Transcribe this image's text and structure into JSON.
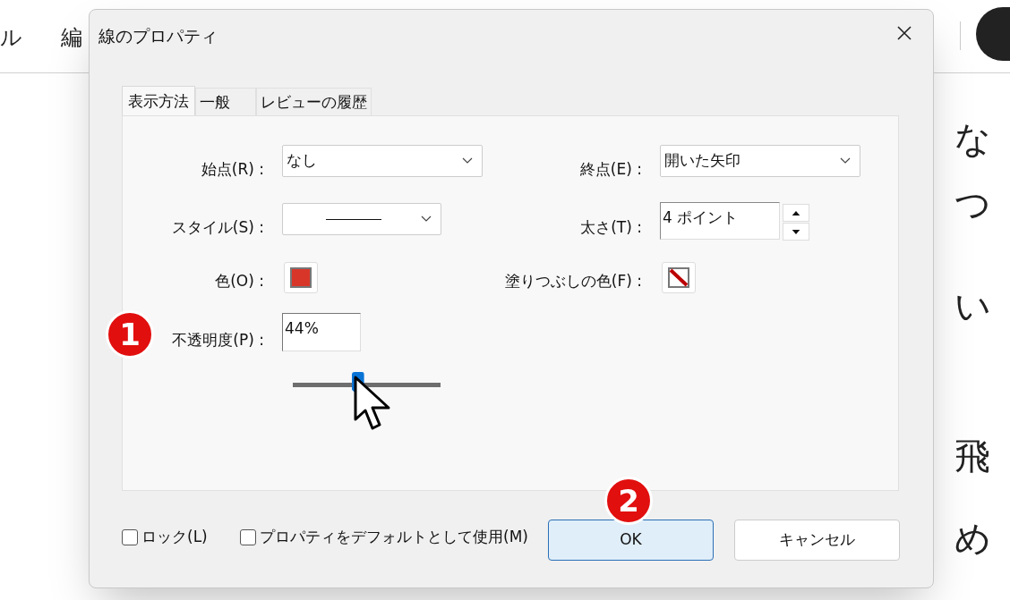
{
  "app": {
    "menu": [
      "ル",
      "編"
    ],
    "document_lines": [
      "な",
      "つ",
      "い",
      "飛",
      "め"
    ]
  },
  "dialog": {
    "title": "線のプロパティ",
    "tabs": [
      {
        "label": "表示方法",
        "selected": true
      },
      {
        "label": "一般",
        "selected": false
      },
      {
        "label": "レビューの履歴",
        "selected": false
      }
    ],
    "start": {
      "label": "始点(R) :",
      "value": "なし"
    },
    "end": {
      "label": "終点(E) :",
      "value": "開いた矢印"
    },
    "style": {
      "label": "スタイル(S) :"
    },
    "thickness": {
      "label": "太さ(T) :",
      "value": "4 ポイント"
    },
    "color": {
      "label": "色(O) :",
      "color": "#d9362a"
    },
    "fill": {
      "label": "塗りつぶしの色(F) :"
    },
    "opacity": {
      "label": "不透明度(P) :",
      "value": "44%",
      "level": 0.44
    },
    "checkboxes": [
      {
        "label": "ロック(L)",
        "checked": false
      },
      {
        "label": "プロパティをデフォルトとして使用(M)",
        "checked": false
      }
    ],
    "buttons": [
      {
        "label": "OK",
        "selected": true
      },
      {
        "label": "キャンセル",
        "selected": false
      }
    ],
    "callouts": [
      "1",
      "2"
    ]
  }
}
